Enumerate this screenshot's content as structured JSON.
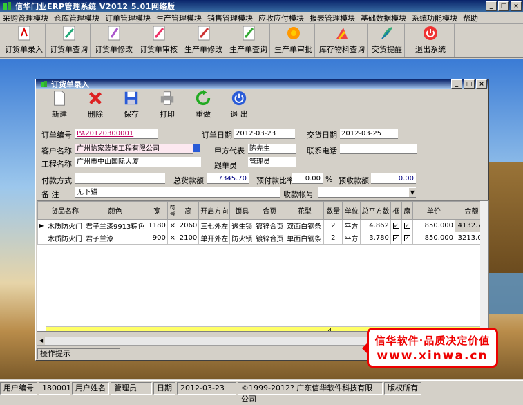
{
  "app": {
    "title": "信华门业ERP管理系统  V2012  5.01网络版",
    "min": "_",
    "max": "□",
    "close": "×"
  },
  "menu": [
    "采购管理模块",
    "仓库管理模块",
    "订单管理模块",
    "生产管理模块",
    "销售管理模块",
    "应收应付模块",
    "报表管理模块",
    "基础数据模块",
    "系统功能模块",
    "帮助"
  ],
  "toolbar": [
    "订货单录入",
    "订货单查询",
    "订货单修改",
    "订货单审核",
    "生产单修改",
    "生产单查询",
    "生产单审批",
    "库存物料查询",
    "交货提醒",
    "退出系统"
  ],
  "child": {
    "title": "订货单录入",
    "buttons": [
      "新建",
      "删除",
      "保存",
      "打印",
      "重做",
      "退 出"
    ]
  },
  "form": {
    "order_no_label": "订单编号",
    "order_no": "PA20120300001",
    "order_date_label": "订单日期",
    "order_date": "2012-03-23",
    "delivery_date_label": "交货日期",
    "delivery_date": "2012-03-25",
    "customer_label": "客户名称",
    "customer": "广州怡家装饰工程有限公司",
    "rep_label": "甲方代表",
    "rep": "陈先生",
    "phone_label": "联系电话",
    "phone": "",
    "project_label": "工程名称",
    "project": "广州市中山国际大厦",
    "follower_label": "跟单员",
    "follower": "管理员",
    "payment_label": "付款方式",
    "payment": "",
    "total_label": "总货款额",
    "total": "7345.70",
    "prepay_ratio_label": "预付款比率",
    "prepay_ratio": "0.00",
    "percent": "%",
    "prepay_label": "预收款额",
    "prepay": "0.00",
    "note_label": "备  注",
    "note": "无下锚",
    "account_label": "收款帐号",
    "account": ""
  },
  "grid": {
    "headers": [
      "货品名称",
      "颜色",
      "宽",
      "符号",
      "高",
      "开启方向",
      "锁具",
      "合页",
      "花型",
      "数量",
      "单位",
      "总平方数",
      "框",
      "扇",
      "单价",
      "金额"
    ],
    "rows": [
      [
        "木质防火门",
        "君子兰漆9913粽色",
        "1180",
        "×",
        "2060",
        "三七外左",
        "逃生锁",
        "镀锌合页",
        "双面白钢条",
        "2",
        "平方",
        "4.862",
        "✓",
        "✓",
        "850.000",
        "4132.70"
      ],
      [
        "木质防火门",
        "君子兰漆",
        "900",
        "×",
        "2100",
        "单开外左",
        "防火锁",
        "镀锌合页",
        "单面白钢条",
        "2",
        "平方",
        "3.780",
        "✓",
        "✓",
        "850.000",
        "3213.00"
      ]
    ],
    "sum_qty": "4"
  },
  "hint": "操作提示",
  "status": [
    "用户编号",
    "180001",
    "用户姓名",
    "管理员",
    "日期",
    "2012-03-23",
    "©1999-2012?  广东信华软件科技有限公司",
    "版权所有"
  ],
  "stamp": {
    "line1": "信华软件·品质决定价值",
    "line2": "www.xinwa.cn"
  }
}
